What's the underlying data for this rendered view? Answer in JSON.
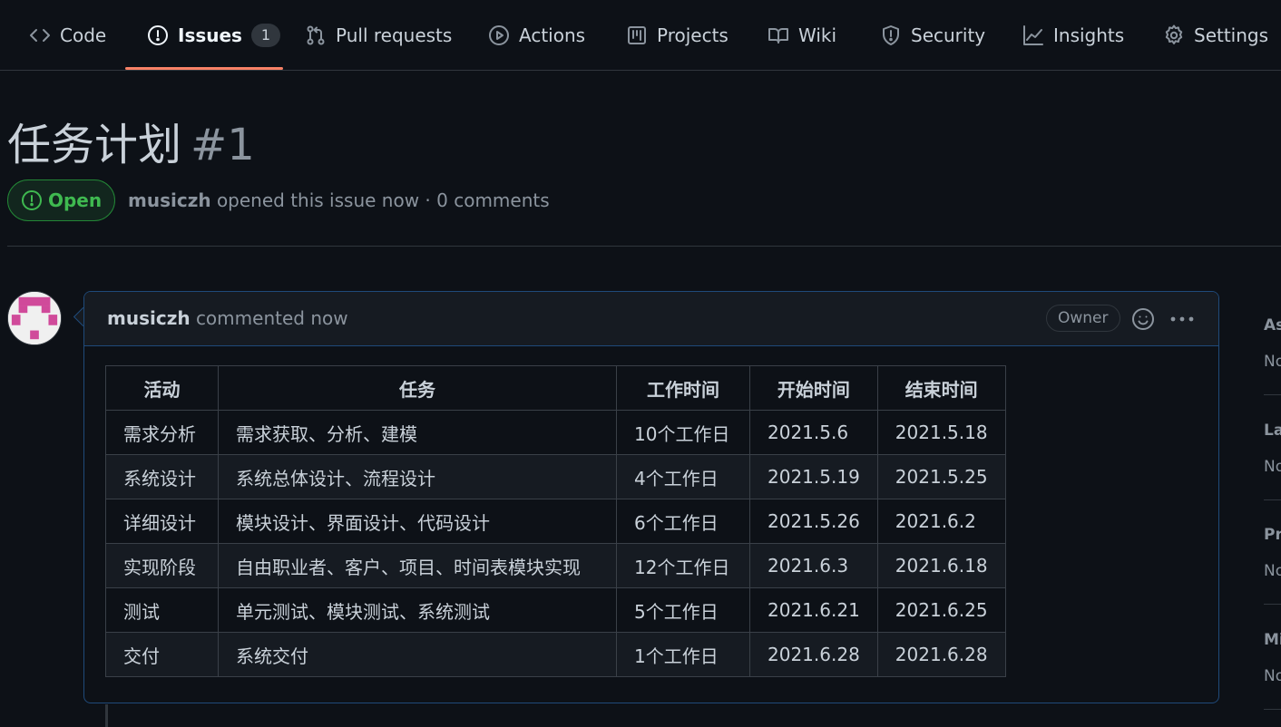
{
  "tabs": [
    {
      "label": "Code",
      "icon": "code-icon"
    },
    {
      "label": "Issues",
      "icon": "issue-opened-icon",
      "counter": "1",
      "selected": true
    },
    {
      "label": "Pull requests",
      "icon": "git-pull-request-icon"
    },
    {
      "label": "Actions",
      "icon": "play-icon"
    },
    {
      "label": "Projects",
      "icon": "project-icon"
    },
    {
      "label": "Wiki",
      "icon": "book-icon"
    },
    {
      "label": "Security",
      "icon": "shield-icon"
    },
    {
      "label": "Insights",
      "icon": "graph-icon"
    },
    {
      "label": "Settings",
      "icon": "gear-icon"
    }
  ],
  "issue": {
    "title": "任务计划",
    "number": "#1",
    "state": "Open",
    "author": "musiczh",
    "meta_text": "opened this issue now · 0 comments"
  },
  "comment": {
    "author": "musiczh",
    "action": "commented now",
    "role_label": "Owner",
    "table": {
      "headers": [
        "活动",
        "任务",
        "工作时间",
        "开始时间",
        "结束时间"
      ],
      "rows": [
        [
          "需求分析",
          "需求获取、分析、建模",
          "10个工作日",
          "2021.5.6",
          "2021.5.18"
        ],
        [
          "系统设计",
          "系统总体设计、流程设计",
          "4个工作日",
          "2021.5.19",
          "2021.5.25"
        ],
        [
          "详细设计",
          "模块设计、界面设计、代码设计",
          "6个工作日",
          "2021.5.26",
          "2021.6.2"
        ],
        [
          "实现阶段",
          "自由职业者、客户、项目、时间表模块实现",
          "12个工作日",
          "2021.6.3",
          "2021.6.18"
        ],
        [
          "测试",
          "单元测试、模块测试、系统测试",
          "5个工作日",
          "2021.6.21",
          "2021.6.25"
        ],
        [
          "交付",
          "系统交付",
          "1个工作日",
          "2021.6.28",
          "2021.6.28"
        ]
      ]
    }
  },
  "sidebar": {
    "sections": [
      {
        "heading": "As",
        "value": "No"
      },
      {
        "heading": "La",
        "value": "No"
      },
      {
        "heading": "Pr",
        "value": "No"
      },
      {
        "heading": "Mi",
        "value": "No"
      }
    ]
  },
  "colors": {
    "background": "#0d1117",
    "accent_underline": "#f78166",
    "open_green": "#3fb950",
    "comment_border": "#1f4a7a"
  }
}
